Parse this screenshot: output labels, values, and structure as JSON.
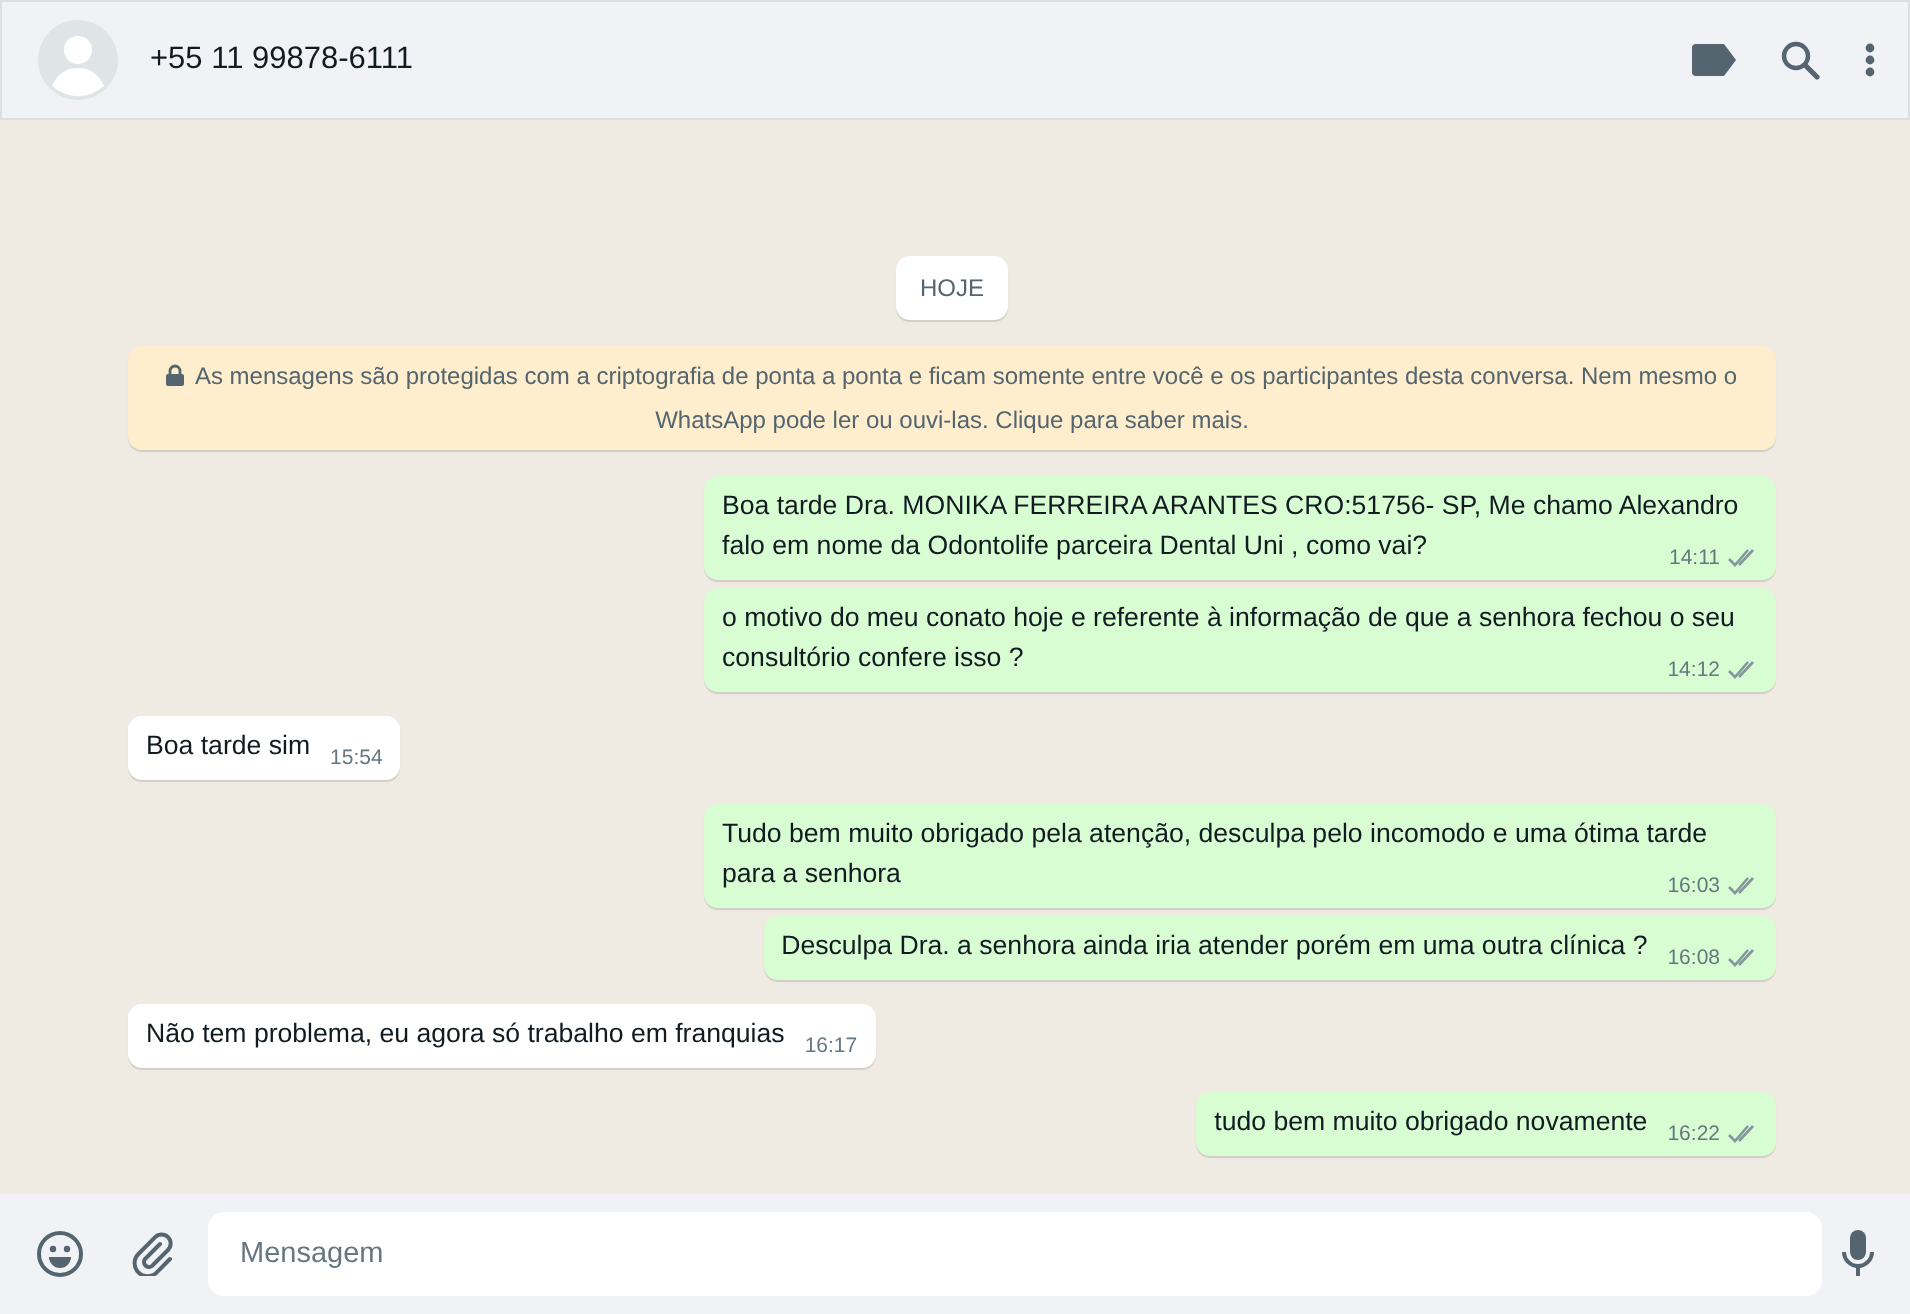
{
  "header": {
    "contact": "+55 11 99878-6111"
  },
  "date_chip": "HOJE",
  "encryption_notice": "As mensagens são protegidas com a criptografia de ponta a ponta e ficam somente entre você e os participantes desta conversa. Nem mesmo o WhatsApp pode ler ou ouvi-las. Clique para saber mais.",
  "messages": [
    {
      "outgoing": true,
      "text": "Boa tarde Dra. MONIKA FERREIRA ARANTES CRO:51756- SP, Me chamo Alexandro falo em nome da Odontolife parceira Dental Uni , como vai?",
      "time": "14:11",
      "read": false
    },
    {
      "outgoing": true,
      "text": "o motivo do meu conato hoje e referente à informação de que a senhora fechou o seu consultório confere isso ?",
      "time": "14:12",
      "read": false
    },
    {
      "outgoing": false,
      "text": "Boa tarde sim",
      "time": "15:54"
    },
    {
      "outgoing": true,
      "text": "Tudo bem muito obrigado pela atenção, desculpa pelo incomodo e uma ótima tarde para a senhora",
      "time": "16:03",
      "read": false
    },
    {
      "outgoing": true,
      "text": "Desculpa Dra. a senhora ainda iria atender porém em uma outra clínica ?",
      "time": "16:08",
      "read": false
    },
    {
      "outgoing": false,
      "text": "Não tem problema, eu agora só trabalho em franquias",
      "time": "16:17"
    },
    {
      "outgoing": true,
      "text": "tudo bem muito obrigado novamente",
      "time": "16:22",
      "read": false
    }
  ],
  "composer": {
    "placeholder": "Mensagem"
  }
}
